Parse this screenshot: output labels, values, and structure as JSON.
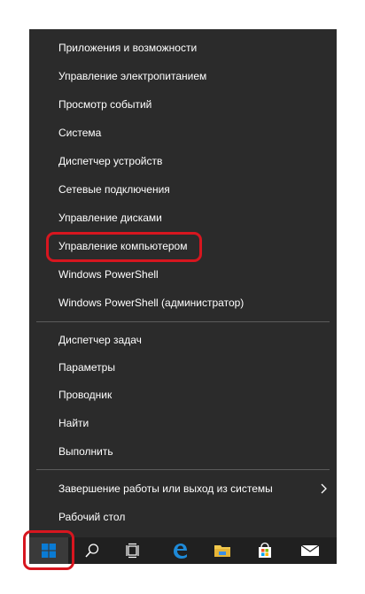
{
  "menu": {
    "group1": [
      "Приложения и возможности",
      "Управление электропитанием",
      "Просмотр событий",
      "Система",
      "Диспетчер устройств",
      "Сетевые подключения",
      "Управление дисками",
      "Управление компьютером",
      "Windows PowerShell",
      "Windows PowerShell (администратор)"
    ],
    "group2": [
      "Диспетчер задач",
      "Параметры",
      "Проводник",
      "Найти",
      "Выполнить"
    ],
    "group3": [
      "Завершение работы или выход из системы",
      "Рабочий стол"
    ]
  },
  "highlighted_item": "Управление компьютером",
  "colors": {
    "menu_bg": "#2b2b2b",
    "taskbar_bg": "#202020",
    "highlight": "#d7161f",
    "windows_blue": "#0a7bd4",
    "edge_blue": "#1e8ad8",
    "folder_yellow": "#f2c94c"
  },
  "taskbar": {
    "icons": [
      "windows-icon",
      "search-icon",
      "task-view-icon",
      "edge-icon",
      "file-explorer-icon",
      "store-icon",
      "mail-icon"
    ]
  }
}
